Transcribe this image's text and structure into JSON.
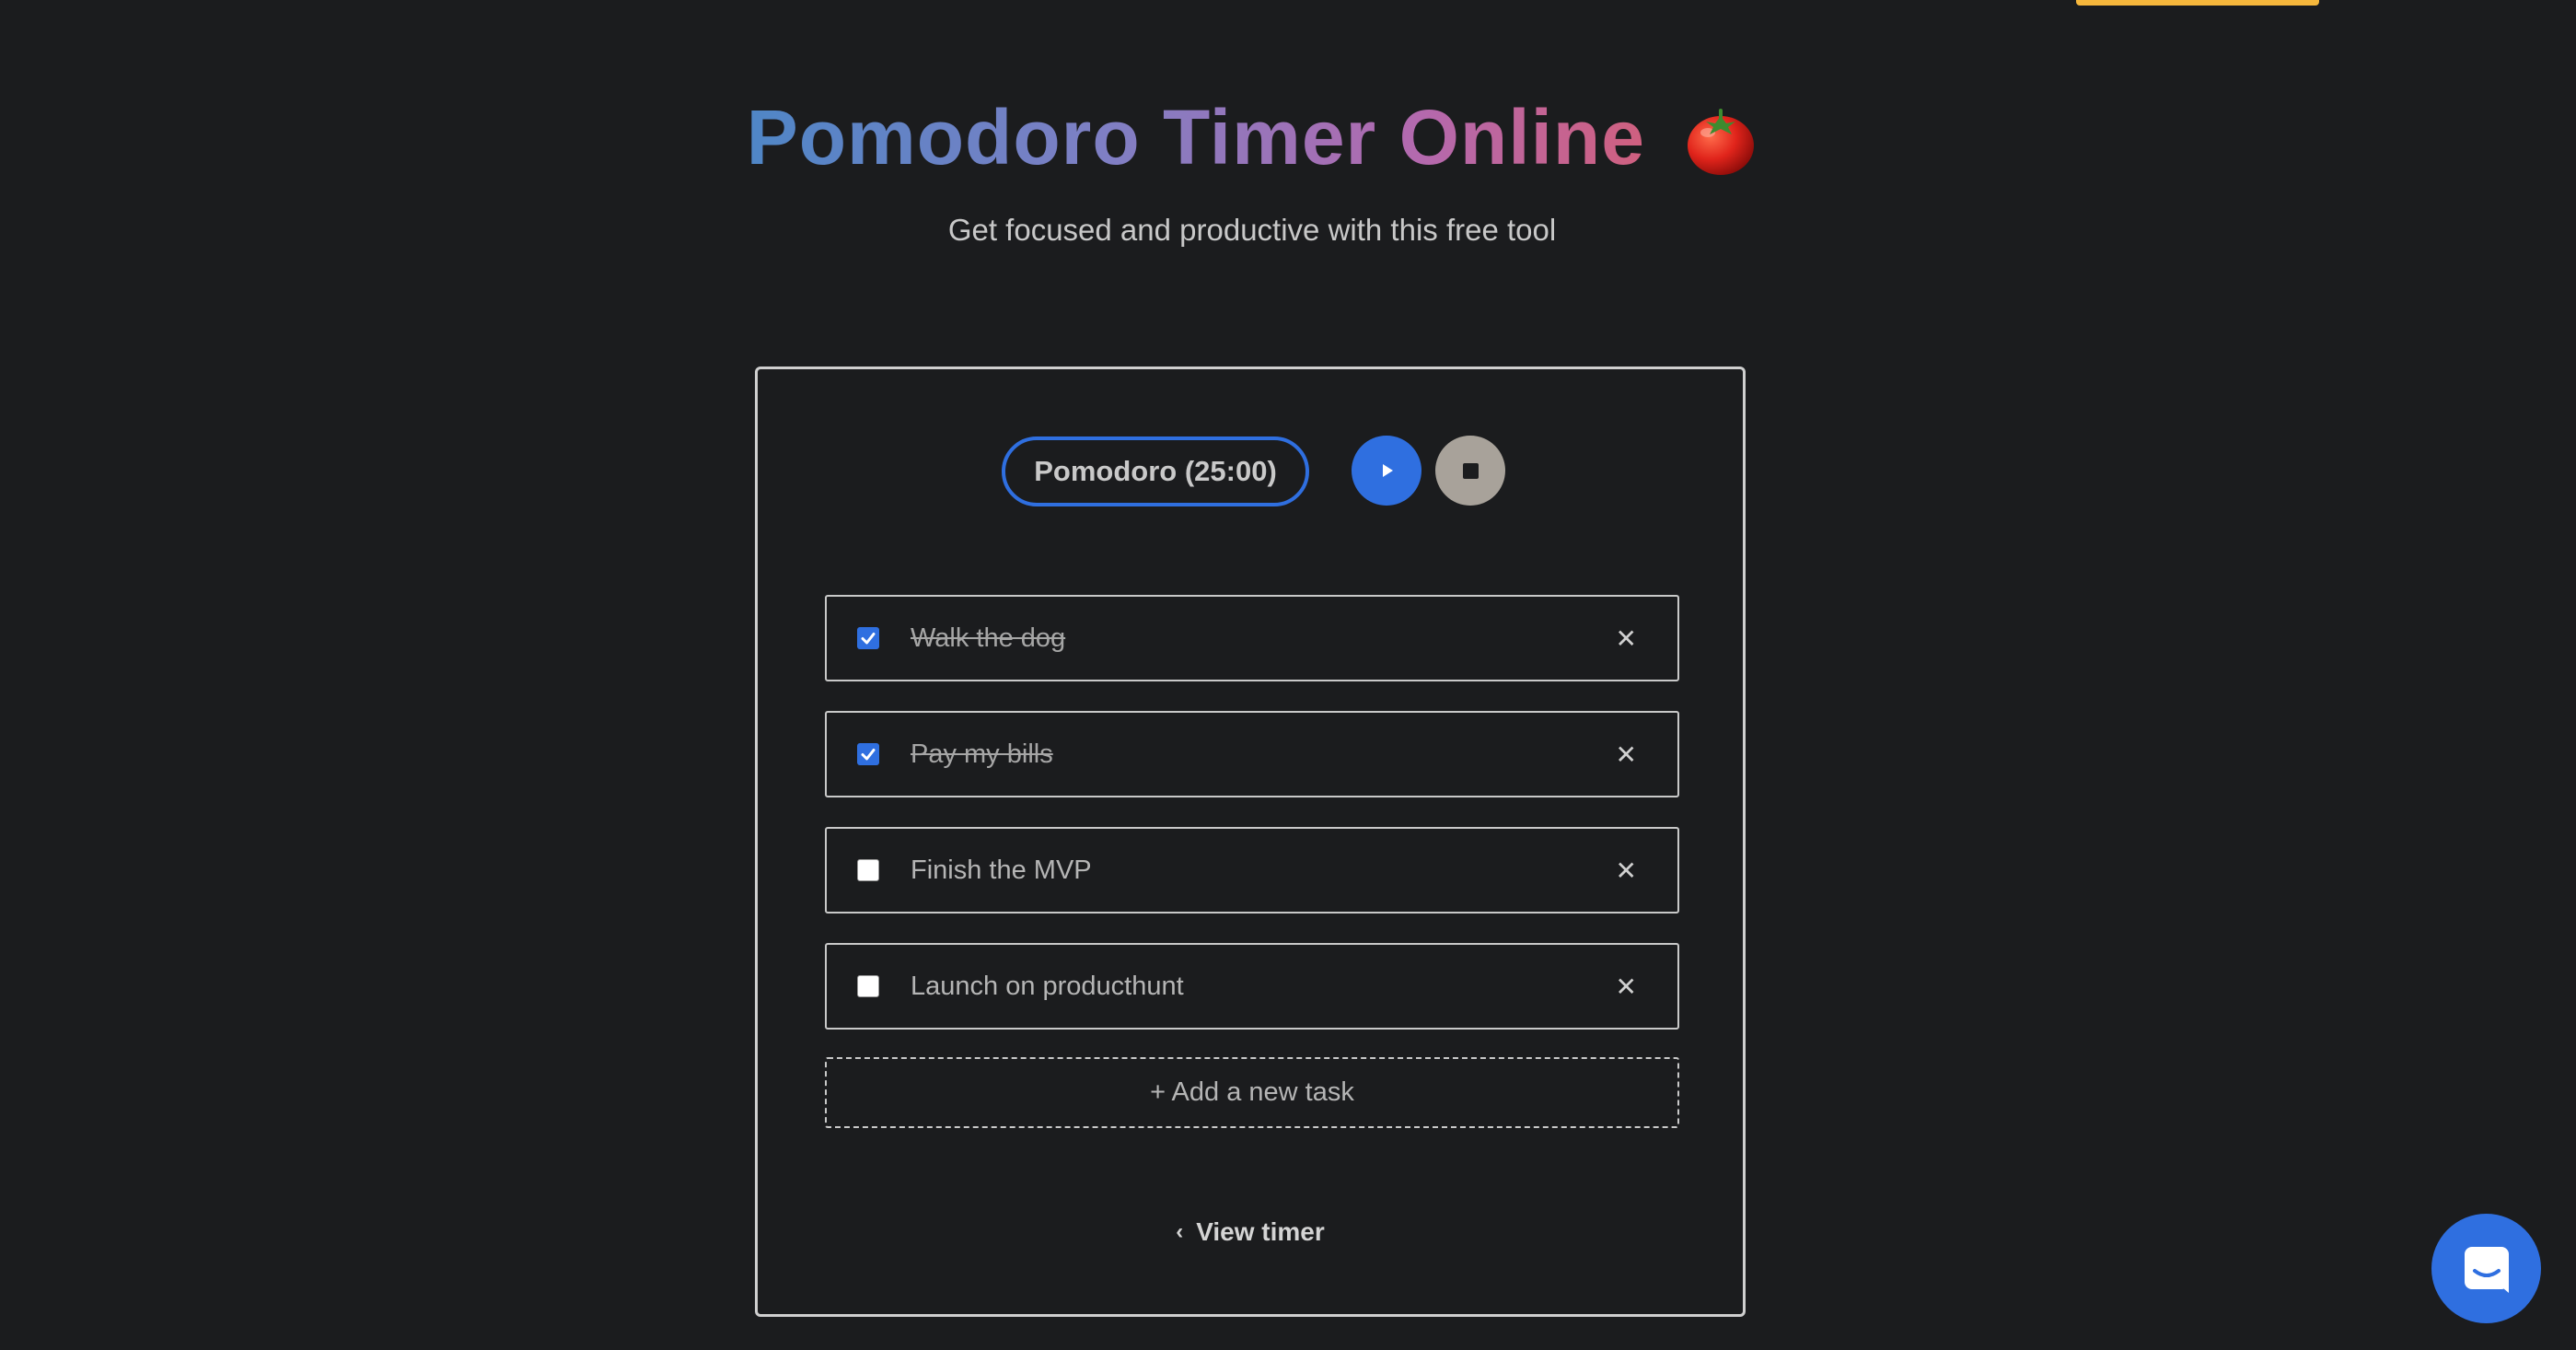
{
  "header": {
    "title": "Pomodoro Timer Online",
    "subtitle": "Get focused and productive with this free tool"
  },
  "timer": {
    "mode_label": "Pomodoro (25:00)"
  },
  "tasks": [
    {
      "label": "Walk the dog",
      "done": true
    },
    {
      "label": "Pay my bills",
      "done": true
    },
    {
      "label": "Finish the MVP",
      "done": false
    },
    {
      "label": "Launch on producthunt",
      "done": false
    }
  ],
  "add_task_label": "+ Add a new task",
  "view_timer_label": "View timer",
  "colors": {
    "accent": "#2f6fe0",
    "background": "#1b1c1e",
    "top_bar": "#f6b73c",
    "stop_button": "#a8a29a"
  },
  "icons": {
    "title_emoji": "tomato-icon",
    "play": "play-icon",
    "stop": "stop-icon",
    "remove": "close-icon",
    "chat": "chat-icon"
  }
}
